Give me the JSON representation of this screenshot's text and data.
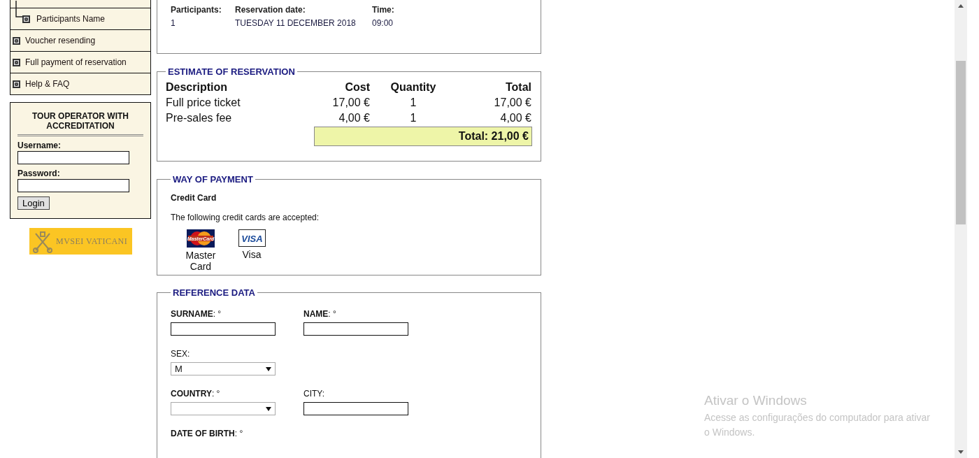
{
  "sidebar": {
    "menu": [
      {
        "label": "Participants Name",
        "kind": "subitem"
      },
      {
        "label": "Voucher resending",
        "kind": "item"
      },
      {
        "label": "Full payment of reservation",
        "kind": "item"
      },
      {
        "label": "Help & FAQ",
        "kind": "item"
      }
    ],
    "login": {
      "title": "TOUR OPERATOR WITH ACCREDITATION",
      "fields": [
        {
          "label": "Username:"
        },
        {
          "label": "Password:"
        }
      ],
      "button": "Login"
    },
    "logo": {
      "text": "MVSEI VATICANI"
    }
  },
  "summary": {
    "fields": [
      {
        "label": "Participants:",
        "value": "1"
      },
      {
        "label": "Reservation date:",
        "value": "TUESDAY 11 DECEMBER 2018"
      },
      {
        "label": "Time:",
        "value": "09:00"
      }
    ]
  },
  "estimate": {
    "title": "ESTIMATE OF RESERVATION",
    "columns": [
      "Description",
      "Cost",
      "Quantity",
      "Total"
    ],
    "rows": [
      [
        "Full price ticket",
        "17,00 €",
        "1",
        "17,00 €"
      ],
      [
        "Pre-sales fee",
        "4,00 €",
        "1",
        "4,00 €"
      ]
    ],
    "total": "Total: 21,00 €"
  },
  "payment": {
    "title": "WAY OF PAYMENT",
    "method": "Credit Card",
    "note": "The following credit cards are accepted:",
    "cards": [
      {
        "kind": "mastercard",
        "logo_text": "MasterCard",
        "label": "Master Card"
      },
      {
        "kind": "visa",
        "logo_text": "VISA",
        "label": "Visa"
      }
    ]
  },
  "reference": {
    "title": "REFERENCE DATA",
    "rows": [
      [
        {
          "label": "**SURNAME**: °",
          "kind": "text"
        },
        {
          "label": "**NAME**: °",
          "kind": "text"
        }
      ],
      [
        {
          "label": "SEX:",
          "kind": "select",
          "value": "M"
        }
      ],
      [
        {
          "label": "**COUNTRY**: °",
          "kind": "select"
        },
        {
          "label": "CITY:",
          "kind": "text"
        }
      ],
      [
        {
          "label": "**DATE OF BIRTH**: °",
          "kind": "none"
        }
      ]
    ]
  },
  "windows_notice": {
    "title": "Ativar o Windows",
    "message": "Acesse as configurações do computador para ativar o Windows."
  }
}
